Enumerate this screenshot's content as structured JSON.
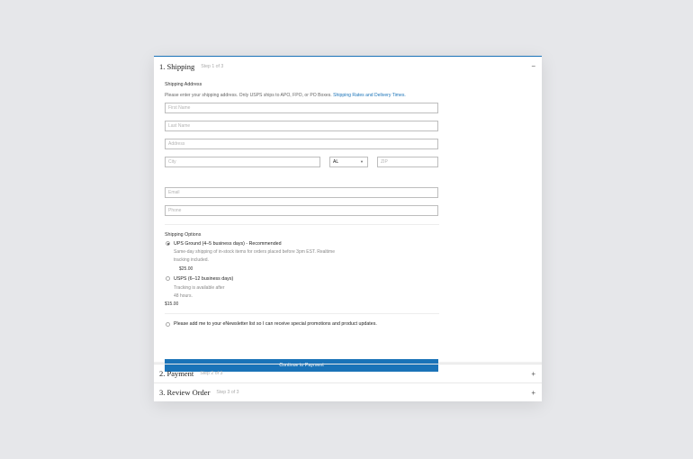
{
  "steps": [
    {
      "title": "1. Shipping",
      "step": "Step 1 of 3",
      "toggle": "−"
    },
    {
      "title": "2. Payment",
      "step": "Step 2 of 3",
      "toggle": "+"
    },
    {
      "title": "3. Review Order",
      "step": "Step 3 of 3",
      "toggle": "+"
    }
  ],
  "shipping_address": {
    "heading": "Shipping Address",
    "note": "Please enter your shipping address. Only USPS ships to APO, FPO, or PO Boxes.",
    "link": "Shipping Rates and Delivery Times."
  },
  "fields": {
    "first_name": "First Name",
    "last_name": "Last Name",
    "address": "Address",
    "city": "City",
    "state": "AL",
    "zip": "ZIP",
    "email": "Email",
    "phone": "Phone"
  },
  "shipping_options": {
    "heading": "Shipping Options",
    "options": [
      {
        "title": "UPS Ground (4–5 business days) - Recommended",
        "desc1": "Same-day shipping of in-stock items for orders placed before 3pm EST. Realtime",
        "desc2": "tracking included.",
        "price": "$25.00",
        "selected": true
      },
      {
        "title": "USPS (6–12 business days)",
        "desc1": "Tracking is available after",
        "desc2": "48 hours.",
        "price": "$15.00",
        "selected": false
      }
    ]
  },
  "newsletter": "Please add me to your eNewsletter list so I can receive special promotions and product updates.",
  "continue_button": "Continue to Payment",
  "colors": {
    "accent": "#1a73b8",
    "background": "#e6e7ea"
  },
  "icons": {
    "collapse": "minus-icon",
    "expand": "plus-icon",
    "dropdown": "caret-down-icon"
  }
}
